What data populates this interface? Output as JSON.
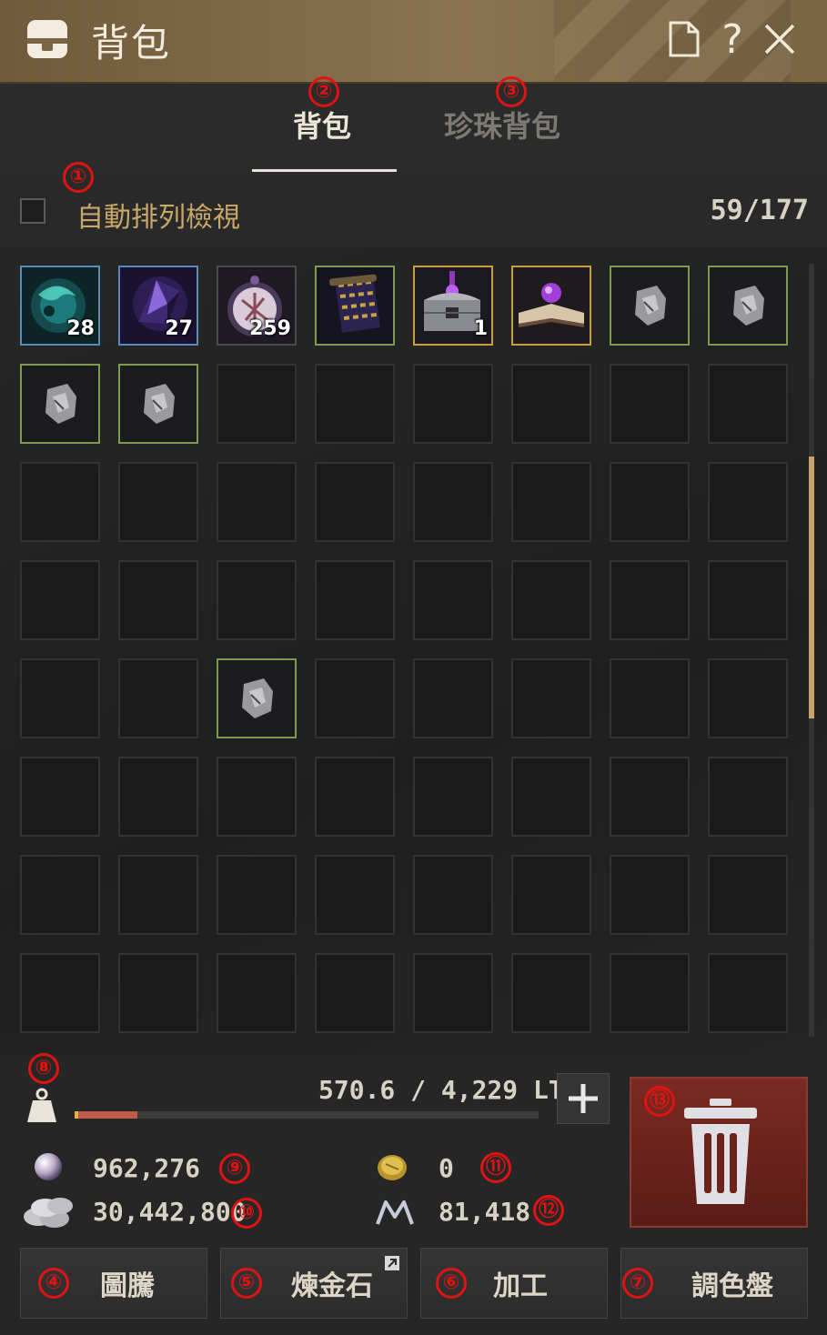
{
  "window": {
    "title": "背包"
  },
  "tabs": [
    {
      "label": "背包",
      "marker": "②",
      "active": true
    },
    {
      "label": "珍珠背包",
      "marker": "③",
      "active": false
    }
  ],
  "options": {
    "auto_sort_label": "自動排列檢視",
    "auto_sort_checked": false,
    "marker": "①",
    "slot_count": "59/177"
  },
  "inventory": {
    "items": [
      {
        "icon": "blue-crystal-icon",
        "quantity": "28",
        "grade": "blue"
      },
      {
        "icon": "purple-shard-icon",
        "quantity": "27",
        "grade": "blue"
      },
      {
        "icon": "rune-disc-icon",
        "quantity": "259",
        "grade": "gray"
      },
      {
        "icon": "scroll-icon",
        "quantity": "",
        "grade": "green"
      },
      {
        "icon": "treasure-chest-icon",
        "quantity": "1",
        "grade": "gold"
      },
      {
        "icon": "magic-book-icon",
        "quantity": "",
        "grade": "gold"
      },
      {
        "icon": "stone-ore-icon",
        "quantity": "",
        "grade": "green"
      },
      {
        "icon": "stone-ore-icon",
        "quantity": "",
        "grade": "green"
      },
      {
        "icon": "stone-ore-icon",
        "quantity": "",
        "grade": "green"
      },
      {
        "icon": "stone-ore-icon",
        "quantity": "",
        "grade": "green"
      },
      {
        "icon": "stone-ore-icon",
        "quantity": "",
        "grade": "green"
      }
    ]
  },
  "weight": {
    "text": "570.6 / 4,229 LT",
    "marker": "⑧",
    "fill_fraction": 0.135
  },
  "currencies": {
    "pearl": {
      "icon": "pearl-icon",
      "value": "962,276",
      "marker": "⑨"
    },
    "silver": {
      "icon": "silver-coins-icon",
      "value": "30,442,800",
      "marker": "⑩"
    },
    "gold_coin": {
      "icon": "gold-coin-icon",
      "value": "0",
      "marker": "⑪"
    },
    "m_point": {
      "icon": "m-point-icon",
      "value": "81,418",
      "marker": "⑫"
    }
  },
  "trash": {
    "marker": "⑬"
  },
  "buttons": [
    {
      "label": "圖騰",
      "marker": "④"
    },
    {
      "label": "煉金石",
      "marker": "⑤"
    },
    {
      "label": "加工",
      "marker": "⑥"
    },
    {
      "label": "調色盤",
      "marker": "⑦"
    }
  ],
  "colors": {
    "accent_gold": "#c8a868",
    "marker_red": "#e01313",
    "titlebar": "#7a6444",
    "trash_red": "#6a241c"
  }
}
